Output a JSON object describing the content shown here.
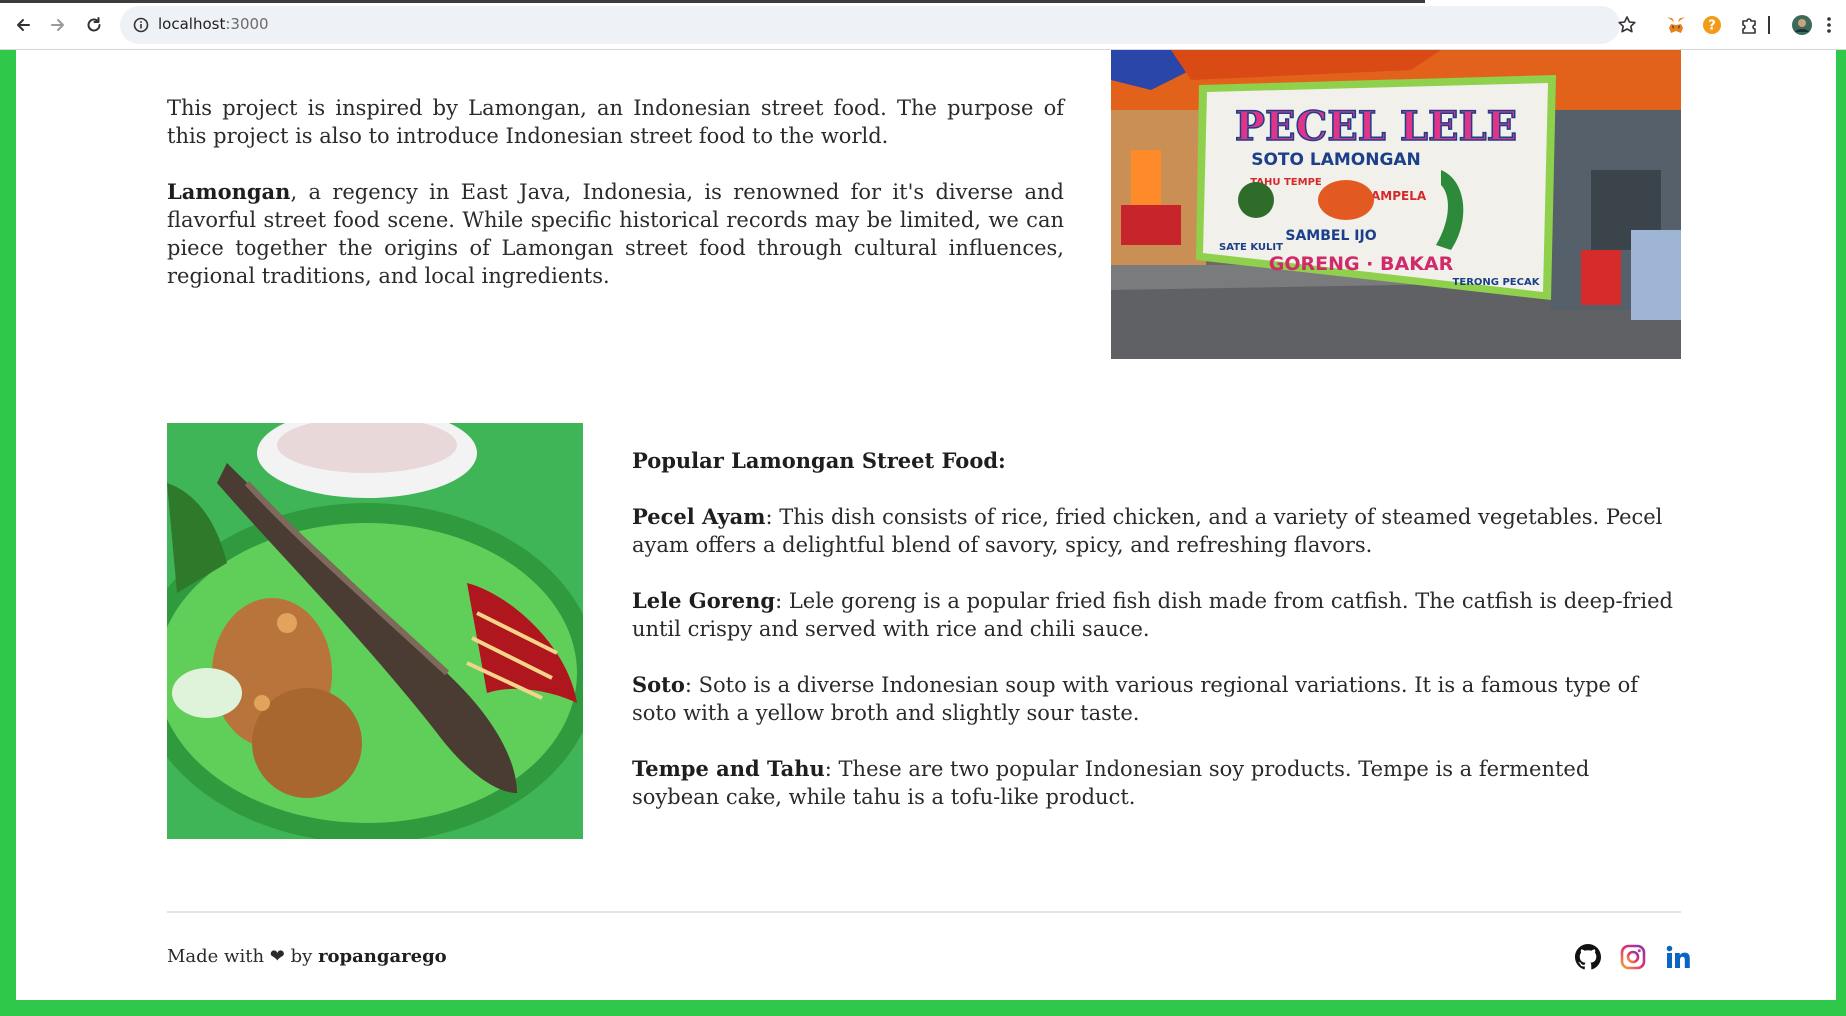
{
  "browser": {
    "url_host": "localhost",
    "url_port": ":3000"
  },
  "intro": {
    "p1": "This project is inspired by Lamongan, an Indonesian street food. The purpose of this project is also to introduce Indonesian street food to the world.",
    "p2_bold": "Lamongan",
    "p2_rest": ", a regency in East Java, Indonesia, is renowned for it's diverse and flavorful street food scene. While specific historical records may be limited, we can piece together the origins of Lamongan street food through cultural influences, regional traditions, and local ingredients."
  },
  "stall_banner": {
    "title": "PECEL LELE",
    "subtitle": "SOTO LAMONGAN",
    "tahu_tempe": "TAHU TEMPE",
    "ati_ampela": "ATI AMPELA",
    "sambel_ijo": "SAMBEL IJO",
    "sate_kulit": "SATE KULIT",
    "goreng_bakar": "GORENG · BAKAR",
    "terong_pecak": "TERONG PECAK"
  },
  "foods": {
    "heading": "Popular Lamongan Street Food:",
    "items": [
      {
        "name": "Pecel Ayam",
        "desc": ": This dish consists of rice, fried chicken, and a variety of steamed vegetables. Pecel ayam offers a delightful blend of savory, spicy, and refreshing flavors."
      },
      {
        "name": "Lele Goreng",
        "desc": ": Lele goreng is a popular fried fish dish made from catfish. The catfish is deep-fried until crispy and served with rice and chili sauce."
      },
      {
        "name": "Soto",
        "desc": ": Soto is a diverse Indonesian soup with various regional variations. It is a famous type of soto with a yellow broth and slightly sour taste."
      },
      {
        "name": "Tempe and Tahu",
        "desc": ": These are two popular Indonesian soy products. Tempe is a fermented soybean cake, while tahu is a tofu-like product."
      }
    ]
  },
  "footer": {
    "made_with": "Made with",
    "heart": "❤",
    "by": "by",
    "author": "ropangarego"
  },
  "icons": {
    "back": "back-arrow-icon",
    "forward": "forward-arrow-icon",
    "reload": "reload-icon",
    "info": "site-info-icon",
    "star": "bookmark-star-icon",
    "github": "github-icon",
    "instagram": "instagram-icon",
    "linkedin": "linkedin-icon"
  },
  "colors": {
    "page_border": "#2fc84a",
    "linkedin": "#0a66c2"
  }
}
